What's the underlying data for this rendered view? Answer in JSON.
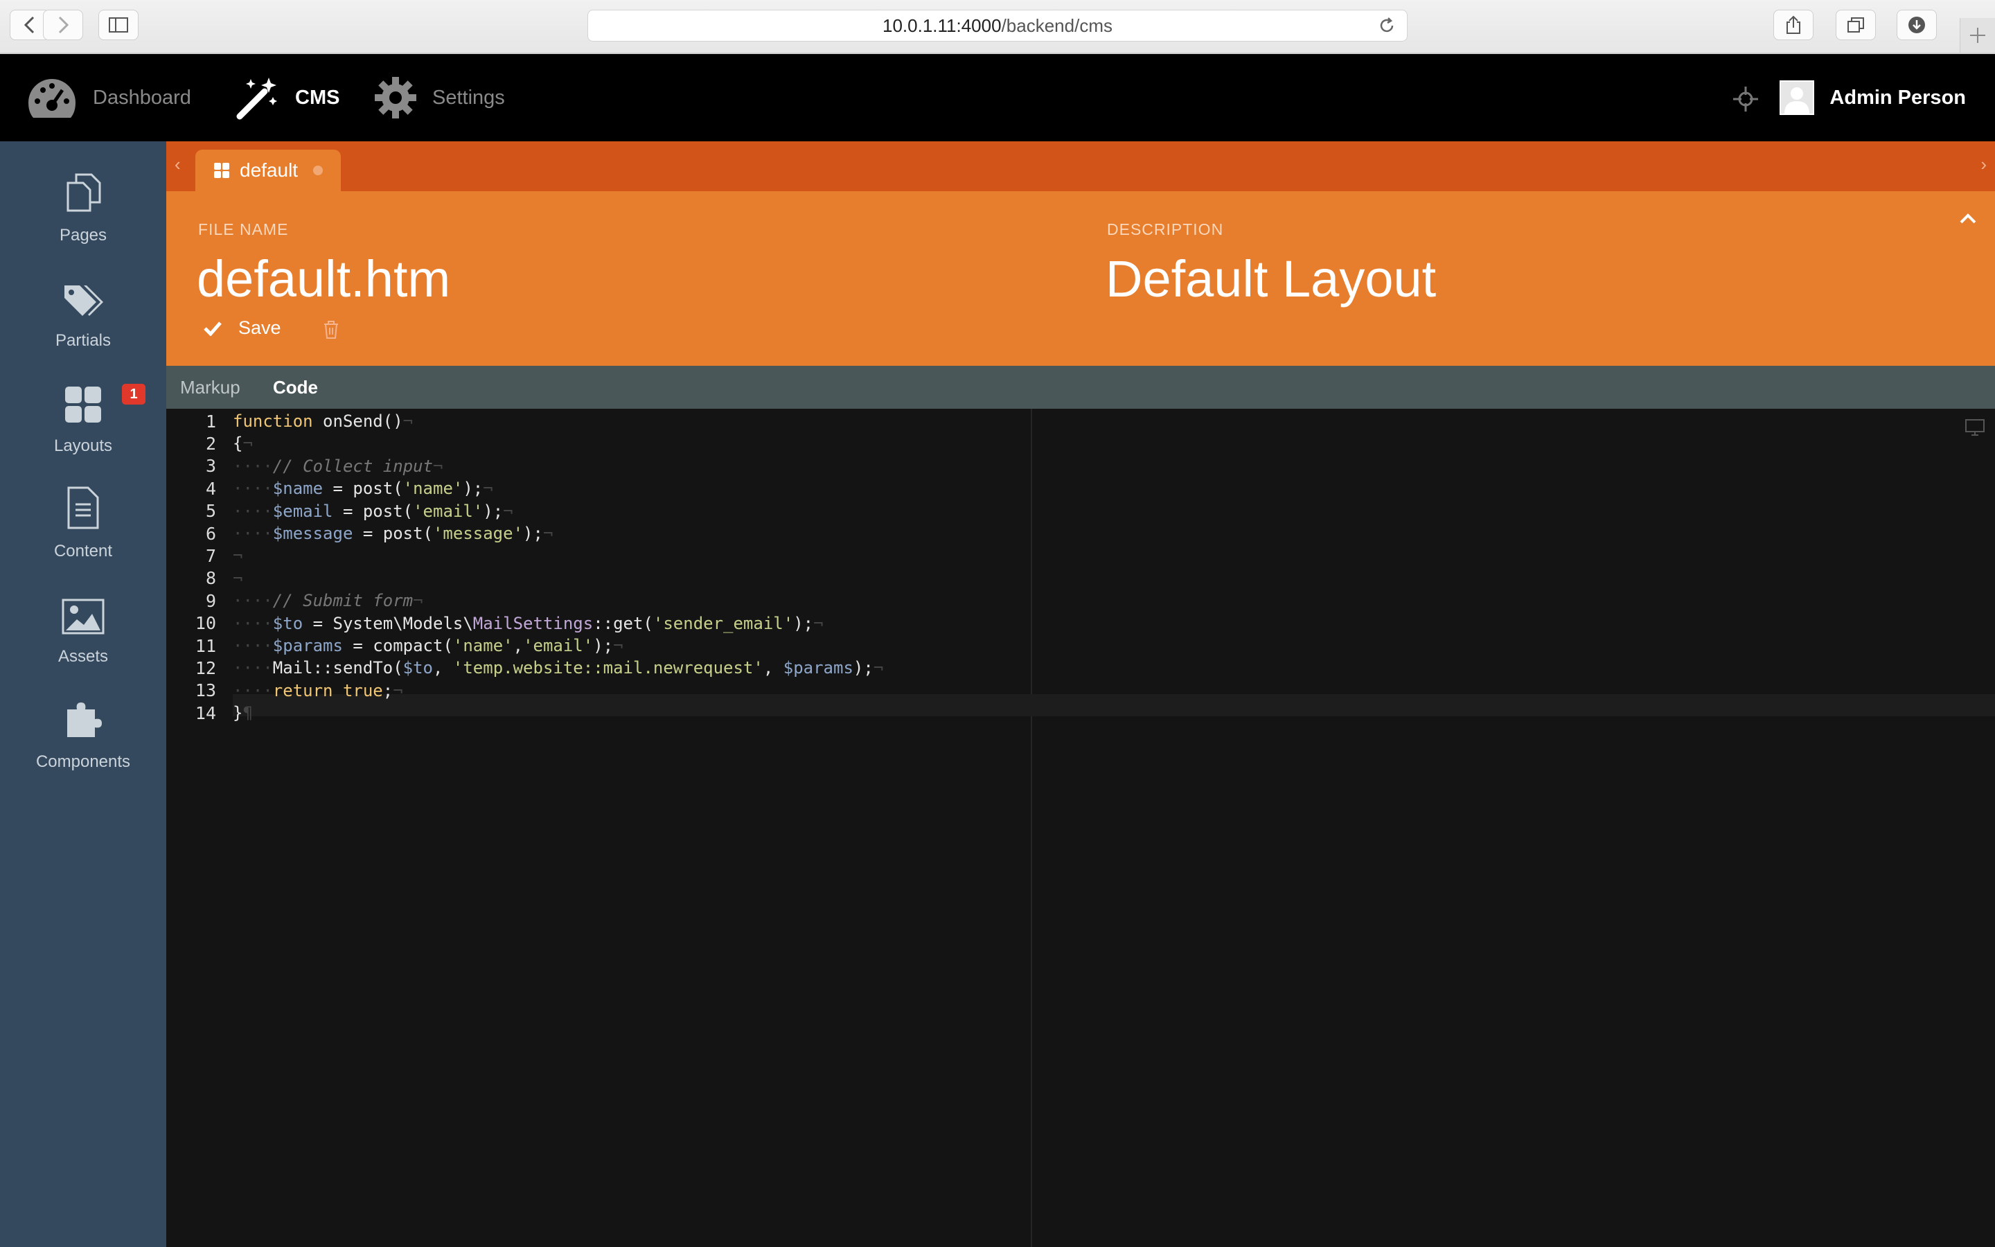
{
  "browser": {
    "url_host": "10.0.1.11:4000",
    "url_path": "/backend/cms"
  },
  "topnav": {
    "items": [
      {
        "label": "Dashboard",
        "icon": "dashboard-icon",
        "active": false
      },
      {
        "label": "CMS",
        "icon": "magic-wand-icon",
        "active": true
      },
      {
        "label": "Settings",
        "icon": "gear-icon",
        "active": false
      }
    ],
    "user_name": "Admin Person"
  },
  "sidebar": {
    "items": [
      {
        "label": "Pages",
        "icon": "pages-icon"
      },
      {
        "label": "Partials",
        "icon": "tags-icon"
      },
      {
        "label": "Layouts",
        "icon": "layouts-icon",
        "badge": "1"
      },
      {
        "label": "Content",
        "icon": "document-icon"
      },
      {
        "label": "Assets",
        "icon": "image-icon"
      },
      {
        "label": "Components",
        "icon": "puzzle-icon"
      }
    ]
  },
  "tabs": {
    "open": [
      {
        "label": "default",
        "icon": "grid-icon"
      }
    ]
  },
  "form": {
    "file_name_label": "FILE NAME",
    "file_name": "default.htm",
    "description_label": "DESCRIPTION",
    "description": "Default Layout",
    "save_label": "Save"
  },
  "code_tabs": [
    "Markup",
    "Code"
  ],
  "editor": {
    "lines": [
      "function onSend()",
      "{",
      "    // Collect input",
      "    $name = post('name');",
      "    $email = post('email');",
      "    $message = post('message');",
      "",
      "",
      "    // Submit form",
      "    $to = System\\Models\\MailSettings::get('sender_email');",
      "    $params = compact('name','email');",
      "    Mail::sendTo($to, 'temp.website::mail.newrequest', $params);",
      "    return true;",
      "}"
    ],
    "active_line": 14
  },
  "colors": {
    "tab_strip": "#d35418",
    "header": "#e67e2d",
    "sidebar": "#34495e",
    "topnav": "#000000",
    "editor_bg": "#141414",
    "badge": "#e0392b"
  }
}
